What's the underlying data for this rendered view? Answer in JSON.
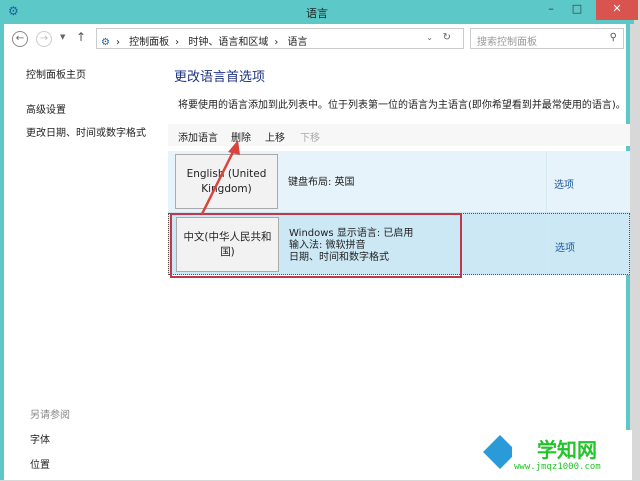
{
  "window": {
    "title": "语言",
    "minimize": "–",
    "maximize": "□",
    "close": "✕"
  },
  "address": {
    "breadcrumbs": [
      "控制面板",
      "时钟、语言和区域",
      "语言"
    ],
    "search_placeholder": "搜索控制面板"
  },
  "sidebar": {
    "items": [
      "控制面板主页",
      "高级设置",
      "更改日期、时间或数字格式"
    ],
    "see_also_title": "另请参阅",
    "see_also": [
      "字体",
      "位置"
    ]
  },
  "main": {
    "title": "更改语言首选项",
    "description": "将要使用的语言添加到此列表中。位于列表第一位的语言为主语言(即你希望看到并最常使用的语言)。",
    "toolbar": [
      "添加语言",
      "删除",
      "上移",
      "下移"
    ],
    "languages": [
      {
        "name": "English (United Kingdom)",
        "info": [
          "键盘布局: 英国"
        ],
        "options": "选项"
      },
      {
        "name": "中文(中华人民共和国)",
        "info": [
          "Windows 显示语言: 已启用",
          "输入法: 微软拼音",
          "日期、时间和数字格式"
        ],
        "options": "选项"
      }
    ]
  },
  "watermark": {
    "name": "学知网",
    "url": "www.jmqz1000.com"
  }
}
